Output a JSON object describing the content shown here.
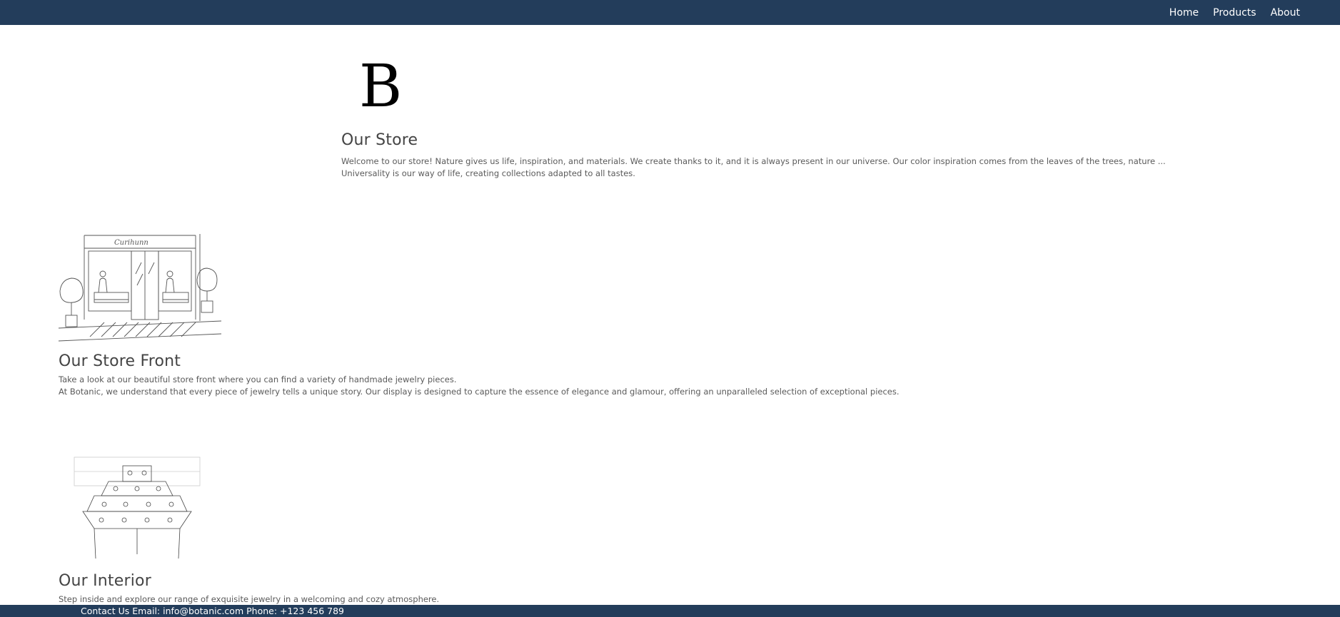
{
  "nav": {
    "home": "Home",
    "products": "Products",
    "about": "About"
  },
  "logo": "B",
  "store": {
    "title": "Our Store",
    "description": "Welcome to our store! Nature gives us life, inspiration, and materials. We create thanks to it, and it is always present in our universe. Our color inspiration comes from the leaves of the trees, nature ... Universality is our way of life, creating collections adapted to all tastes."
  },
  "store_front": {
    "sign_text": "Curihunn",
    "title": "Our Store Front",
    "line1": "Take a look at our beautiful store front where you can find a variety of handmade jewelry pieces.",
    "line2": "At Botanic, we understand that every piece of jewelry tells a unique story. Our display is designed to capture the essence of elegance and glamour, offering an unparalleled selection of exceptional pieces."
  },
  "interior": {
    "title": "Our Interior",
    "line1": "Step inside and explore our range of exquisite jewelry in a welcoming and cozy atmosphere."
  },
  "footer": {
    "text": "Contact Us Email: info@botanic.com Phone: +123 456 789"
  },
  "colors": {
    "navbar": "#233d5b",
    "footer": "#233d5b"
  }
}
